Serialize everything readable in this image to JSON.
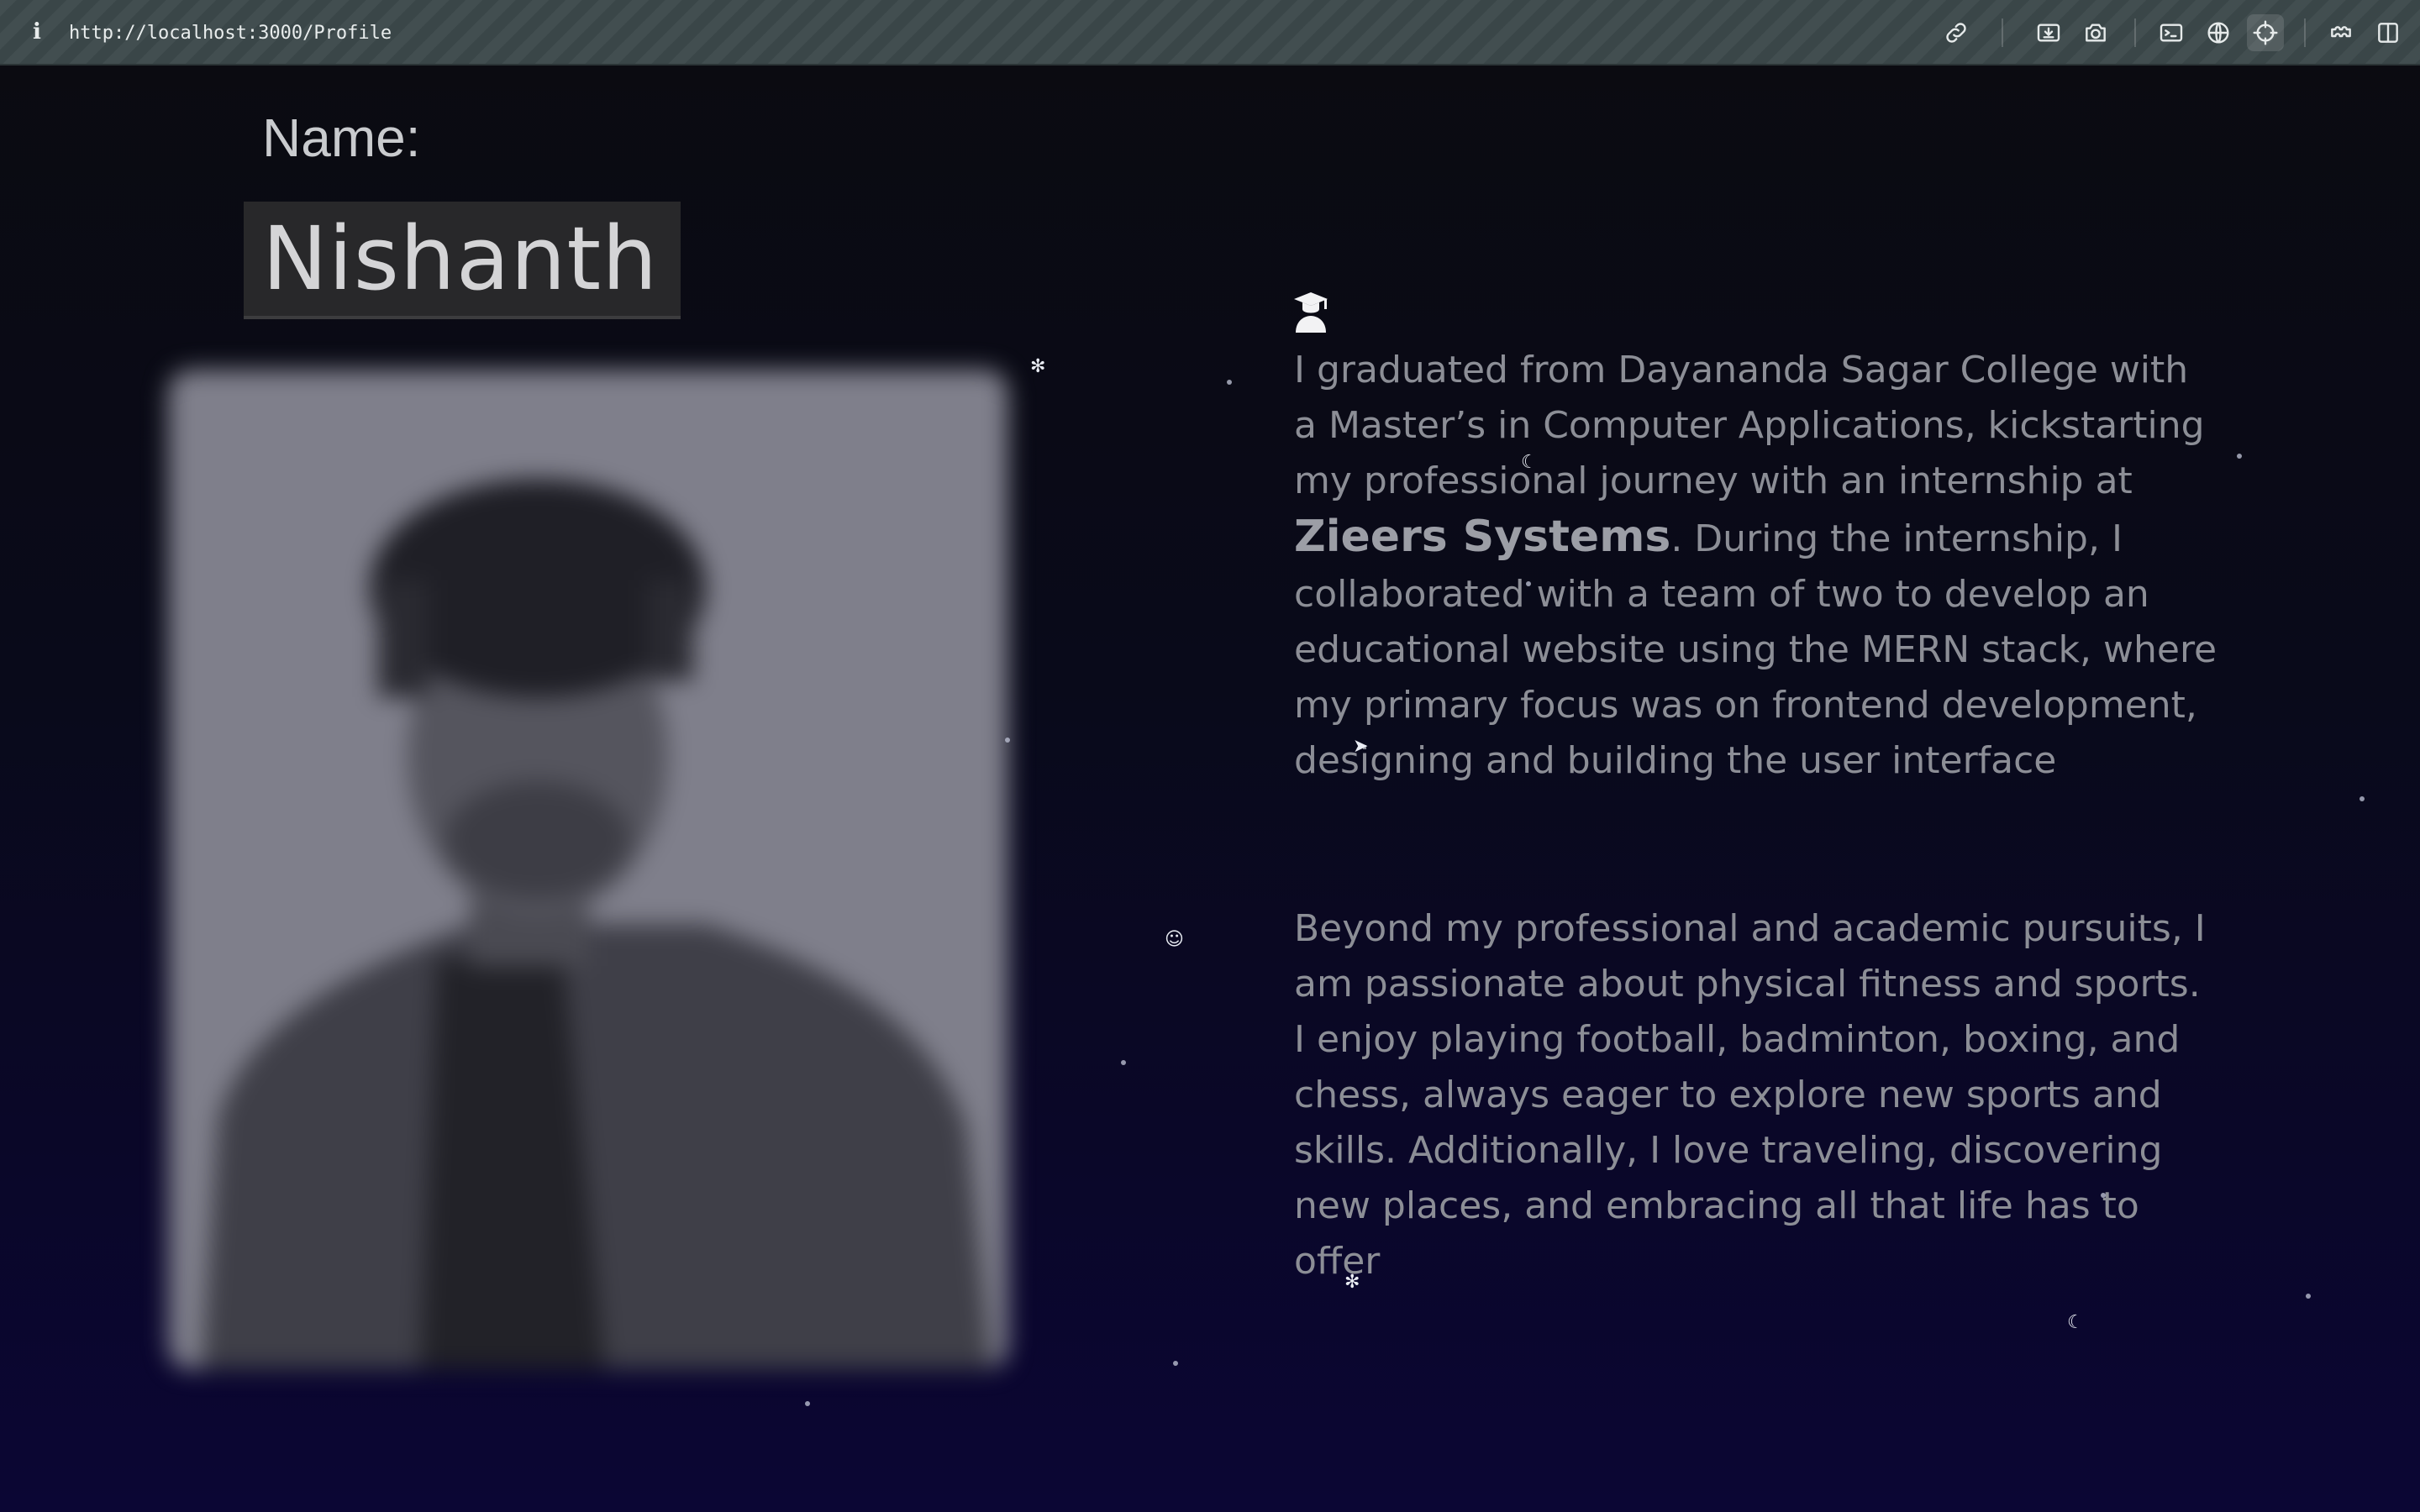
{
  "toolbar": {
    "url": "http://localhost:3000/Profile",
    "icons": [
      "info-icon",
      "link-icon",
      "download-icon",
      "camera-icon",
      "terminal-icon",
      "globe-icon",
      "crosshair-icon",
      "extension-icon",
      "sidebar-icon"
    ]
  },
  "profile": {
    "name_label": "Name:",
    "name_value": "Nishanth",
    "education_icon": "graduation-cap-icon",
    "bio1": {
      "part1": "I graduated from Dayananda Sagar College with a Master’s in Computer Applications, kickstarting my professional journey with an internship at ",
      "company": "Zieers Systems",
      "part2": ". During the internship, I collaborated with a team of two to develop an educational website using the MERN stack, where my primary focus was on frontend development, designing and building the user interface"
    },
    "bio2": "Beyond my professional and academic pursuits, I am passionate about physical fitness and sports. I enjoy playing football, badminton, boxing, and chess, always eager to explore new sports and skills. Additionally, I love traveling, discovering new places, and embracing all that life has to offer"
  },
  "colors": {
    "background_top": "#0b0b10",
    "background_bottom": "#0b0634",
    "text": "#8c8e96",
    "toolbar": "#3a4648"
  }
}
